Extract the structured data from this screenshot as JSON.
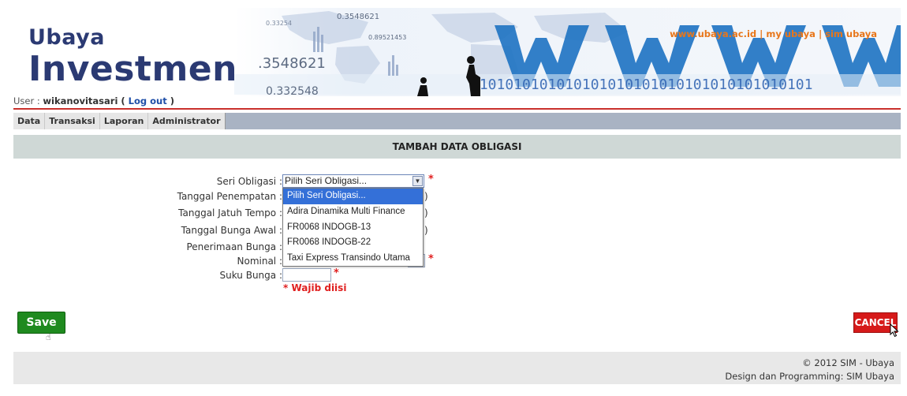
{
  "header": {
    "brand_line1": "Ubaya",
    "brand_line2": "Investment",
    "banner_numbers": [
      "0.33254",
      "0.3548621",
      "0.89521453",
      ".3548621",
      "0.332548"
    ],
    "banner_binary": "0101010101010101010101010101010101010101",
    "top_links": [
      "www.ubaya.ac.id",
      "my ubaya",
      "sim ubaya"
    ],
    "top_links_sep": "|",
    "colors": {
      "brand": "#2b3a73",
      "links": "#e8761a",
      "accent": "#c9302c"
    }
  },
  "user": {
    "prefix": "User : ",
    "username": "wikanovitasari",
    "open": " ( ",
    "logout_label": "Log out",
    "close": " )"
  },
  "menu": {
    "items": [
      "Data",
      "Transaksi",
      "Laporan",
      "Administrator"
    ]
  },
  "page_title": "TAMBAH DATA OBLIGASI",
  "form": {
    "fields": [
      {
        "label": "Seri Obligasi :",
        "required": true
      },
      {
        "label": "Tanggal Penempatan :",
        "suffix": ")"
      },
      {
        "label": "Tanggal Jatuh Tempo :",
        "suffix": ")"
      },
      {
        "label": "Tanggal Bunga Awal :",
        "suffix": ")"
      },
      {
        "label": "Penerimaan Bunga :"
      },
      {
        "label": "Nominal :",
        "required": true
      },
      {
        "label": "Suku Bunga :",
        "required": true
      }
    ],
    "seri_select": {
      "value": "Pilih Seri Obligasi...",
      "options": [
        "Pilih Seri Obligasi...",
        "Adira Dinamika Multi Finance",
        "FR0068 INDOGB-13",
        "FR0068 INDOGB-22",
        "Taxi Express Transindo Utama"
      ],
      "selected_index": 0
    },
    "required_mark": "*",
    "required_note": "* Wajib diisi"
  },
  "buttons": {
    "save": "Save",
    "cancel": "CANCEL"
  },
  "footer": {
    "copyright": "© 2012 SIM - Ubaya",
    "credit": "Design dan Programming: SIM Ubaya"
  }
}
